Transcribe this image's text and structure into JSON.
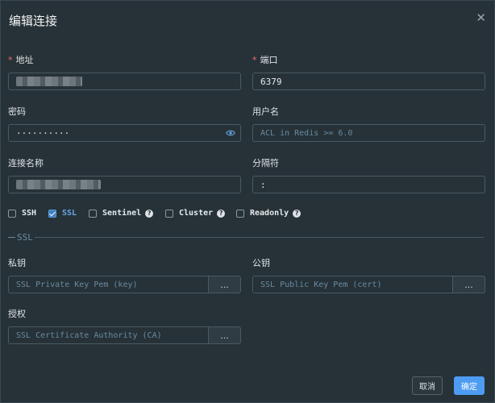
{
  "dialog": {
    "title": "编辑连接",
    "close_glyph": "✕"
  },
  "fields": {
    "address": {
      "label": "地址",
      "required_mark": "*",
      "value": ""
    },
    "port": {
      "label": "端口",
      "required_mark": "*",
      "value": "6379"
    },
    "password": {
      "label": "密码",
      "value": "··········"
    },
    "username": {
      "label": "用户名",
      "placeholder": "ACL in Redis >= 6.0"
    },
    "connection_name": {
      "label": "连接名称",
      "value": ""
    },
    "separator": {
      "label": "分隔符",
      "value": ":"
    },
    "private_key": {
      "label": "私钥",
      "placeholder": "SSL Private Key Pem (key)",
      "button": "..."
    },
    "public_key": {
      "label": "公钥",
      "placeholder": "SSL Public Key Pem (cert)",
      "button": "..."
    },
    "authority": {
      "label": "授权",
      "placeholder": "SSL Certificate Authority (CA)",
      "button": "..."
    }
  },
  "options": [
    {
      "label": "SSH",
      "checked": false,
      "help": false
    },
    {
      "label": "SSL",
      "checked": true,
      "help": false
    },
    {
      "label": "Sentinel",
      "checked": false,
      "help": true
    },
    {
      "label": "Cluster",
      "checked": false,
      "help": true
    },
    {
      "label": "Readonly",
      "checked": false,
      "help": true
    }
  ],
  "help_glyph": "?",
  "section": {
    "label": "SSL"
  },
  "footer": {
    "cancel": "取消",
    "confirm": "确定"
  },
  "colors": {
    "background": "#263238",
    "accent": "#4e9cf2",
    "required": "#f56c6c"
  }
}
